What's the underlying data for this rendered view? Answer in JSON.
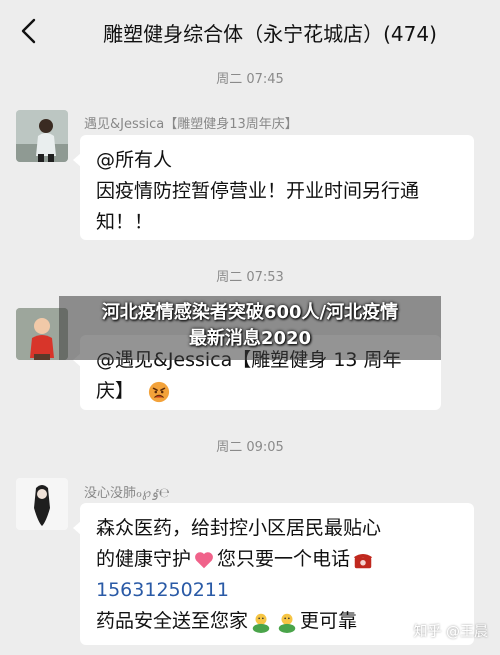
{
  "header": {
    "title": "雕塑健身综合体（永宁花城店）(474)"
  },
  "messages": [
    {
      "time": "周二 07:45",
      "sender": "遇见&Jessica【雕塑健身13周年庆】",
      "lines": [
        "@所有人",
        "因疫情防控暂停营业！开业时间另行通",
        "知！！"
      ]
    },
    {
      "time": "周二 07:53",
      "lines": [
        "@遇见&Jessica【雕塑健身 13 周年",
        "庆】"
      ]
    },
    {
      "time": "周二 09:05",
      "sender": "没心没肺ℴ℘ٶ℮",
      "lines": [
        "森众医药，给封控小区居民最贴心",
        "的健康守护",
        "您只要一个电话",
        "15631250211",
        "药品安全送至您家",
        "更可靠"
      ]
    }
  ],
  "overlay": {
    "line1": "河北疫情感染者突破600人/河北疫情",
    "line2": "最新消息2020"
  },
  "watermark": {
    "text": "知乎 @王晨"
  },
  "colors": {
    "background": "#ededed",
    "bubble": "#ffffff",
    "phone_link": "#2a5aa6",
    "timestamp": "#8a8a8a"
  },
  "icons": {
    "back": "chevron-left-icon",
    "heart": "heart-icon",
    "telephone": "telephone-icon",
    "angry_face": "angry-face-emoji",
    "clapping": "clapping-person-emoji"
  }
}
